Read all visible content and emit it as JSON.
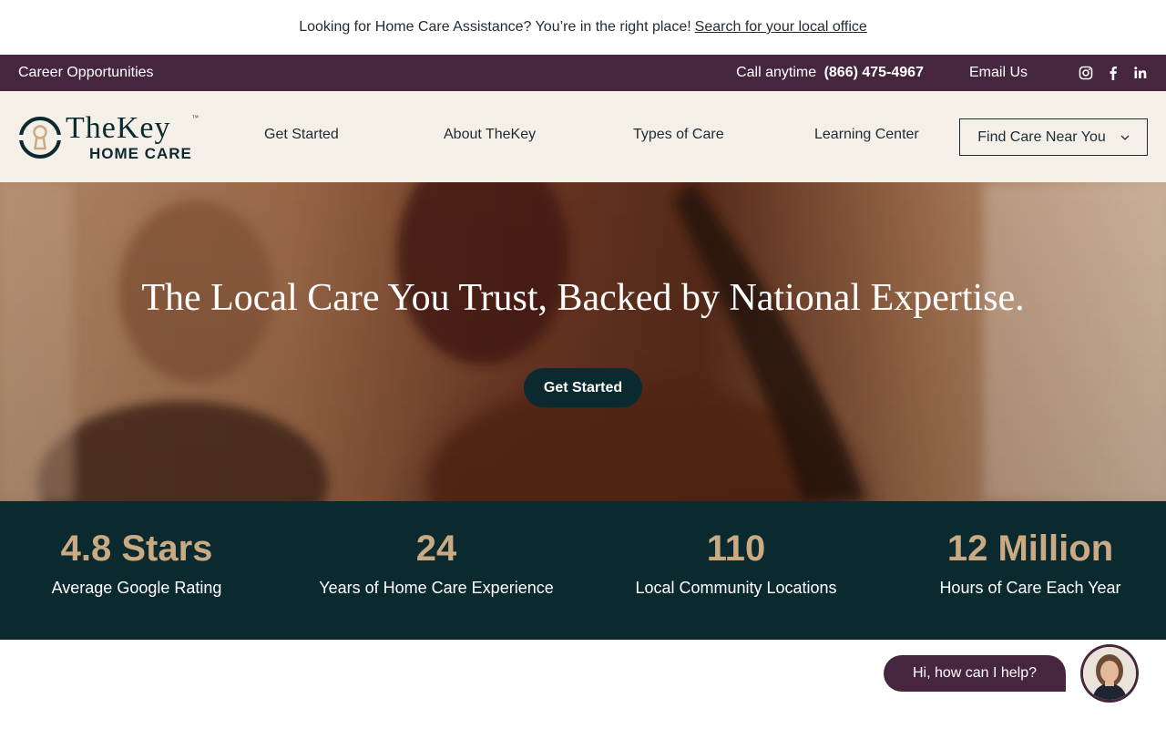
{
  "announcement": {
    "text": "Looking for Home Care Assistance? You’re in the right place!",
    "link": "Search for your local office"
  },
  "utility": {
    "career": "Career Opportunities",
    "call_prefix": "Call anytime",
    "phone": "(866) 475-4967",
    "email": "Email Us",
    "social": [
      "instagram-icon",
      "facebook-icon",
      "linkedin-icon"
    ]
  },
  "logo": {
    "brand": "TheKey",
    "trademark": "™",
    "sub": "HOME CARE"
  },
  "nav": {
    "items": [
      "Get Started",
      "About TheKey",
      "Types of Care",
      "Learning Center"
    ],
    "find_care": "Find Care Near You"
  },
  "hero": {
    "headline": "The Local Care You Trust, Backed by National Expertise.",
    "cta": "Get Started"
  },
  "stats": [
    {
      "value": "4.8 Stars",
      "label": "Average Google Rating"
    },
    {
      "value": "24",
      "label": "Years of Home Care Experience"
    },
    {
      "value": "110",
      "label": "Local Community Locations"
    },
    {
      "value": "12 Million",
      "label": "Hours of Care Each Year"
    }
  ],
  "chat": {
    "prompt": "Hi, how can I help?"
  },
  "colors": {
    "plum": "#46263f",
    "teal_dark": "#0b2a30",
    "cream": "#f4f0e8",
    "gold": "#c9aa82"
  }
}
